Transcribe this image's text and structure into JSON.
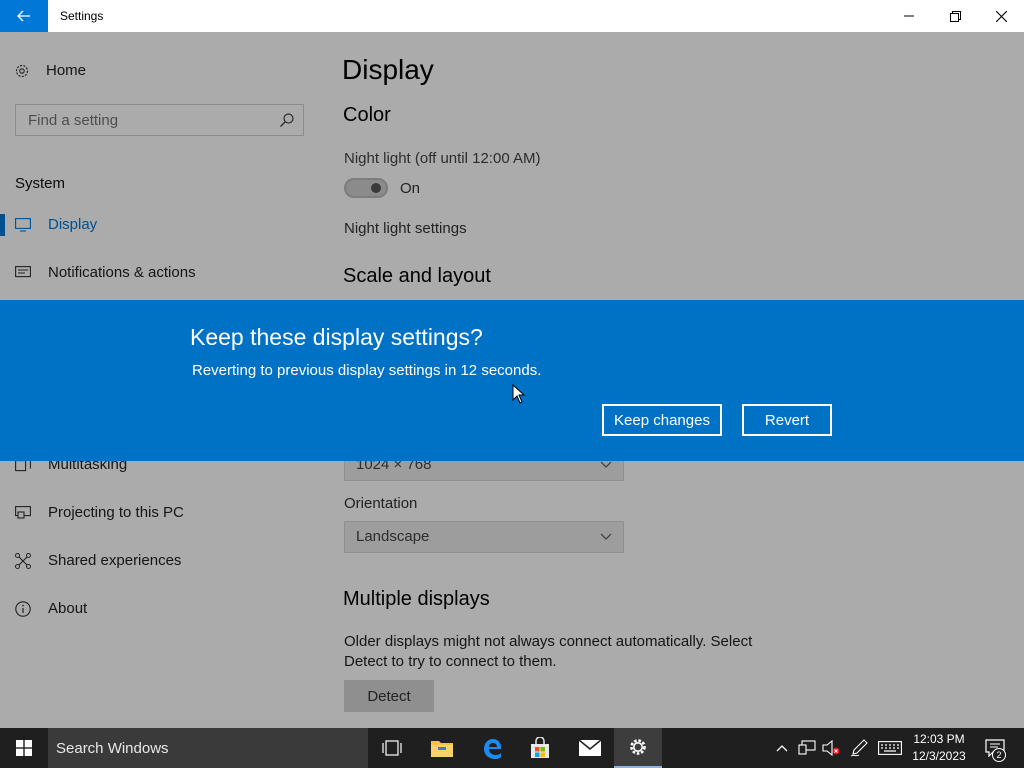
{
  "window": {
    "title": "Settings"
  },
  "sidebar": {
    "home": "Home",
    "search_placeholder": "Find a setting",
    "section": "System",
    "items": [
      {
        "label": "Display",
        "icon": "monitor-icon",
        "active": true
      },
      {
        "label": "Notifications & actions",
        "icon": "notifications-icon"
      },
      {
        "label": "Multitasking",
        "icon": "multitasking-icon"
      },
      {
        "label": "Projecting to this PC",
        "icon": "projecting-icon"
      },
      {
        "label": "Shared experiences",
        "icon": "shared-experiences-icon"
      },
      {
        "label": "About",
        "icon": "info-icon"
      }
    ]
  },
  "main": {
    "title": "Display",
    "color_heading": "Color",
    "night_light_label": "Night light (off until 12:00 AM)",
    "night_light_toggle": "On",
    "night_light_settings": "Night light settings",
    "scale_heading": "Scale and layout",
    "resolution_value": "1024 × 768",
    "orientation_label": "Orientation",
    "orientation_value": "Landscape",
    "multiple_displays_heading": "Multiple displays",
    "multiple_displays_text": "Older displays might not always connect automatically. Select Detect to try to connect to them.",
    "detect_button": "Detect"
  },
  "dialog": {
    "title": "Keep these display settings?",
    "message": "Reverting to previous display settings in 12 seconds.",
    "keep_button": "Keep changes",
    "revert_button": "Revert"
  },
  "taskbar": {
    "search_text": "Search Windows",
    "clock_time": "12:03 PM",
    "clock_date": "12/3/2023",
    "notification_count": "2"
  },
  "colors": {
    "accent": "#0078d7",
    "banner": "#0072c6",
    "taskbar": "#1f1f1f"
  }
}
